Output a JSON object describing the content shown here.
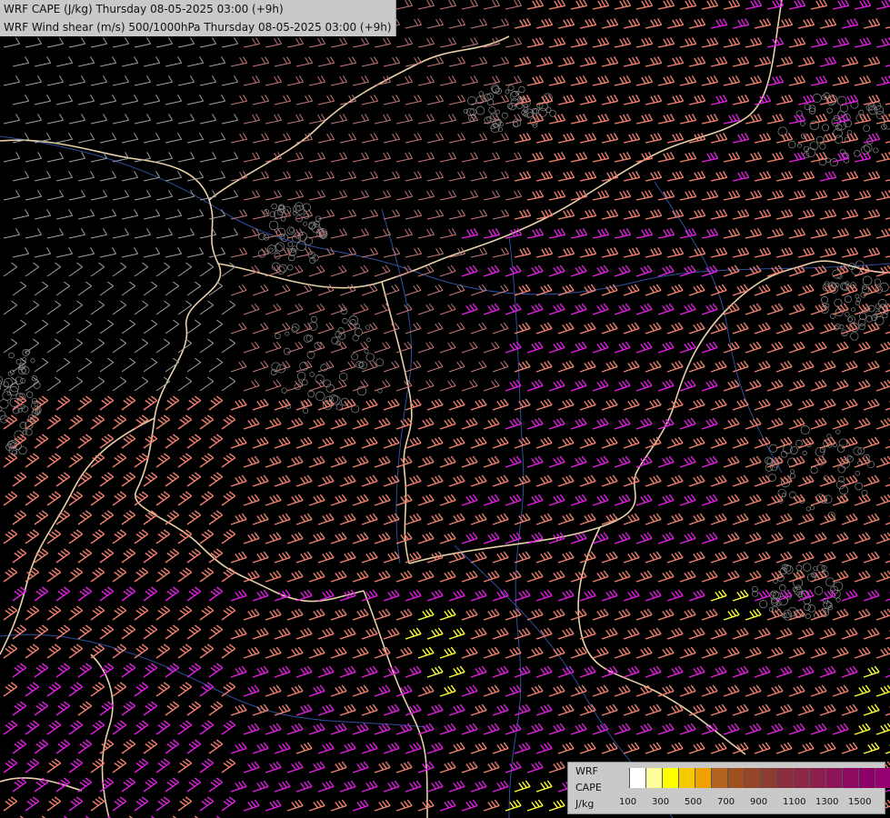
{
  "titles": {
    "line1": "WRF CAPE (J/kg) Thursday 08-05-2025 03:00 (+9h)",
    "line2": "WRF Wind shear (m/s) 500/1000hPa Thursday 08-05-2025 03:00 (+9h)"
  },
  "legend": {
    "label_model": "WRF",
    "label_field": "CAPE",
    "label_unit": "J/kg",
    "swatch_colors": [
      "#c8c8c8",
      "#ffffff",
      "#ffff99",
      "#ffff00",
      "#f5c800",
      "#f0a000",
      "#b4641e",
      "#a0501e",
      "#964628",
      "#8c3c32",
      "#8c2d3c",
      "#8c2846",
      "#8c1e50",
      "#8c1458",
      "#8c0a60",
      "#8c0068",
      "#960070",
      "#a00078"
    ],
    "tick_labels": [
      "100",
      "300",
      "500",
      "700",
      "900",
      "1100",
      "1300",
      "1500"
    ]
  },
  "map": {
    "background": "#000000",
    "barb_colors": {
      "weak": "#a0a0a0",
      "moderate": "#c87878",
      "strong": "#f08070",
      "very_strong": "#e020e0",
      "extreme": "#ffff33"
    },
    "border_color": "#e8d0a8",
    "river_color": "#3050a0",
    "terrain_contour_color": "#8a8a8a"
  }
}
